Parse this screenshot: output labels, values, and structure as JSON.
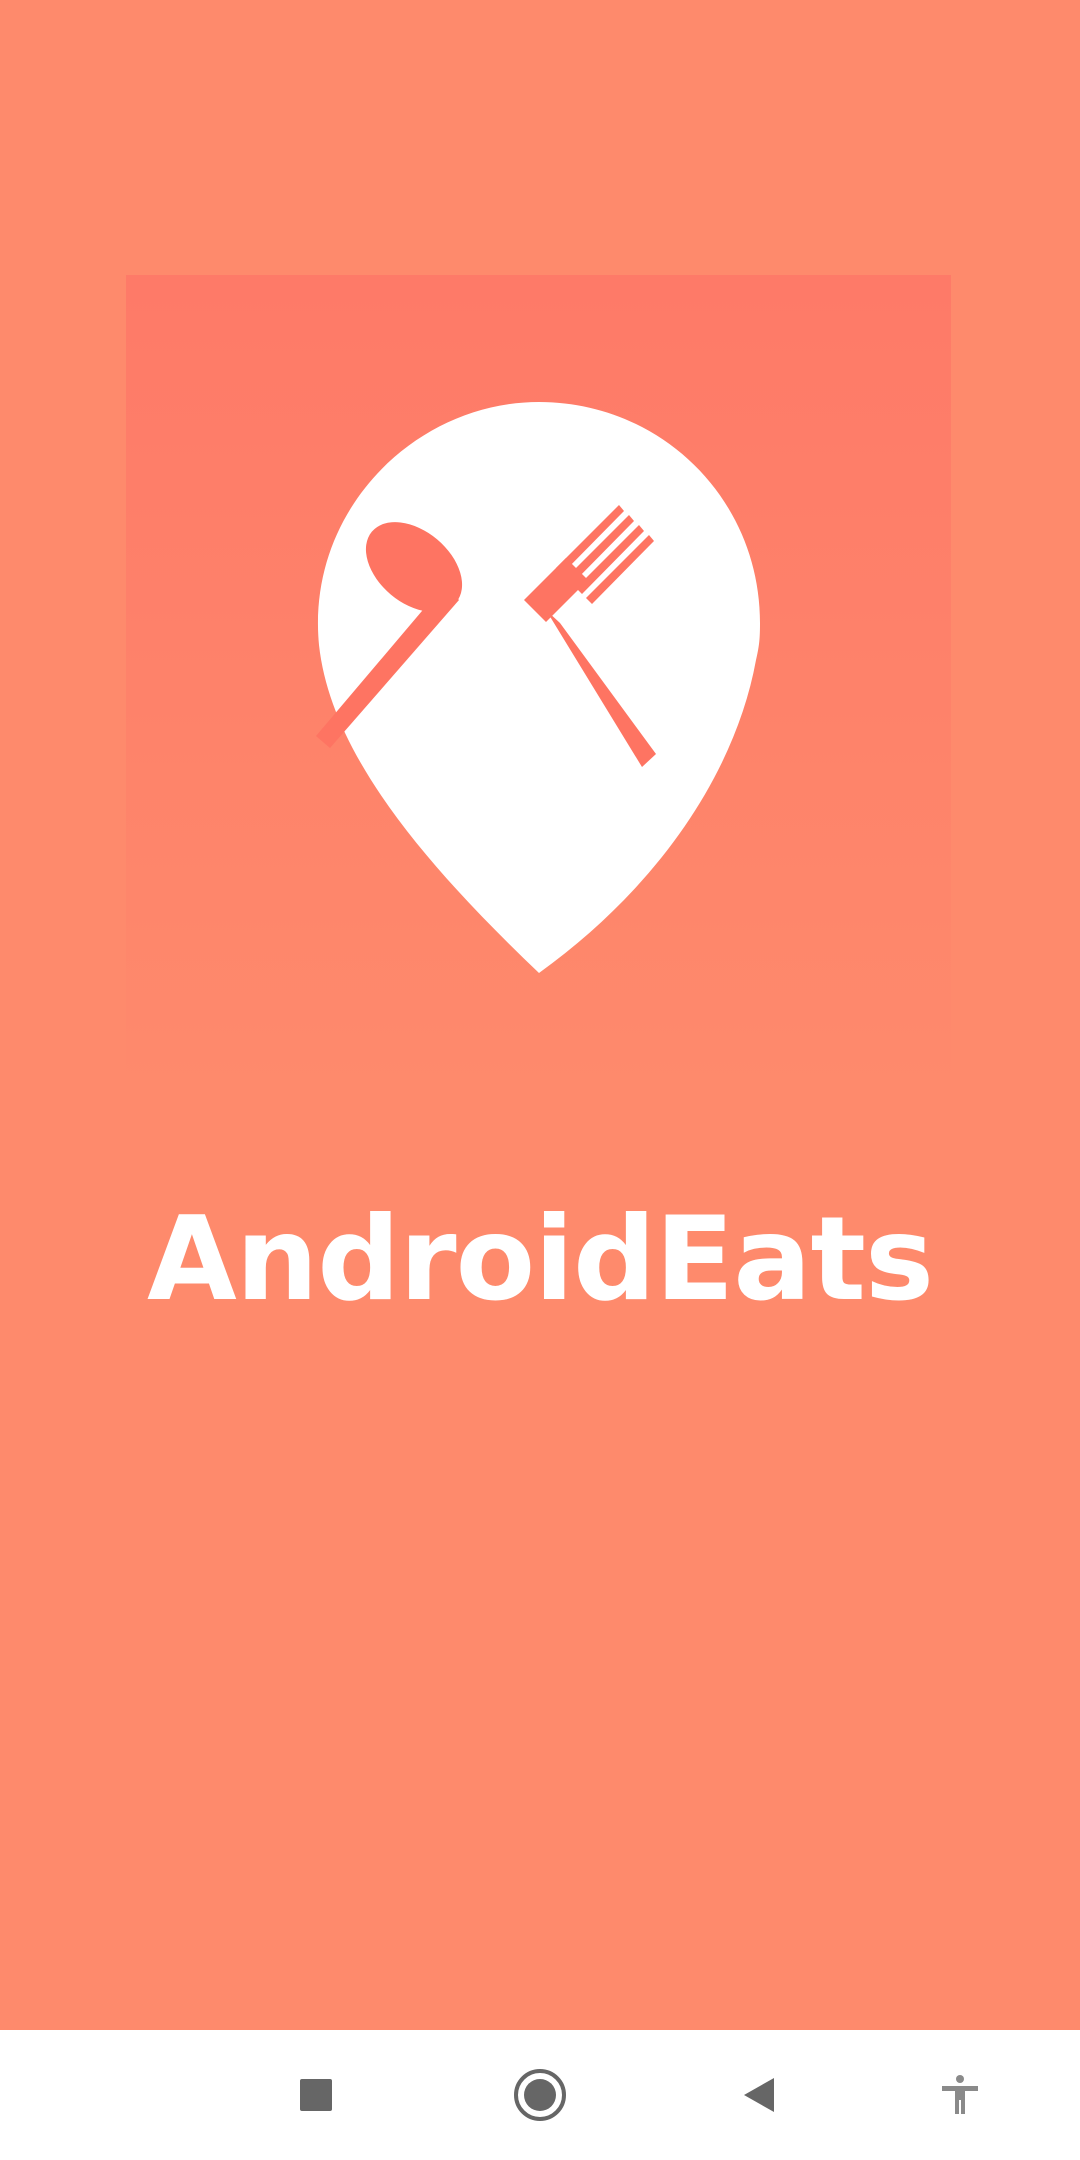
{
  "app": {
    "name": "AndroidEats"
  },
  "logo": {
    "icon": "fork-spoon-location-pin-icon"
  },
  "nav": {
    "recents_icon": "square-icon",
    "home_icon": "circle-icon",
    "back_icon": "triangle-back-icon",
    "accessibility_icon": "accessibility-icon"
  },
  "colors": {
    "background": "#FE8A6C",
    "accent": "#FE7462",
    "nav_icon": "#666666"
  }
}
